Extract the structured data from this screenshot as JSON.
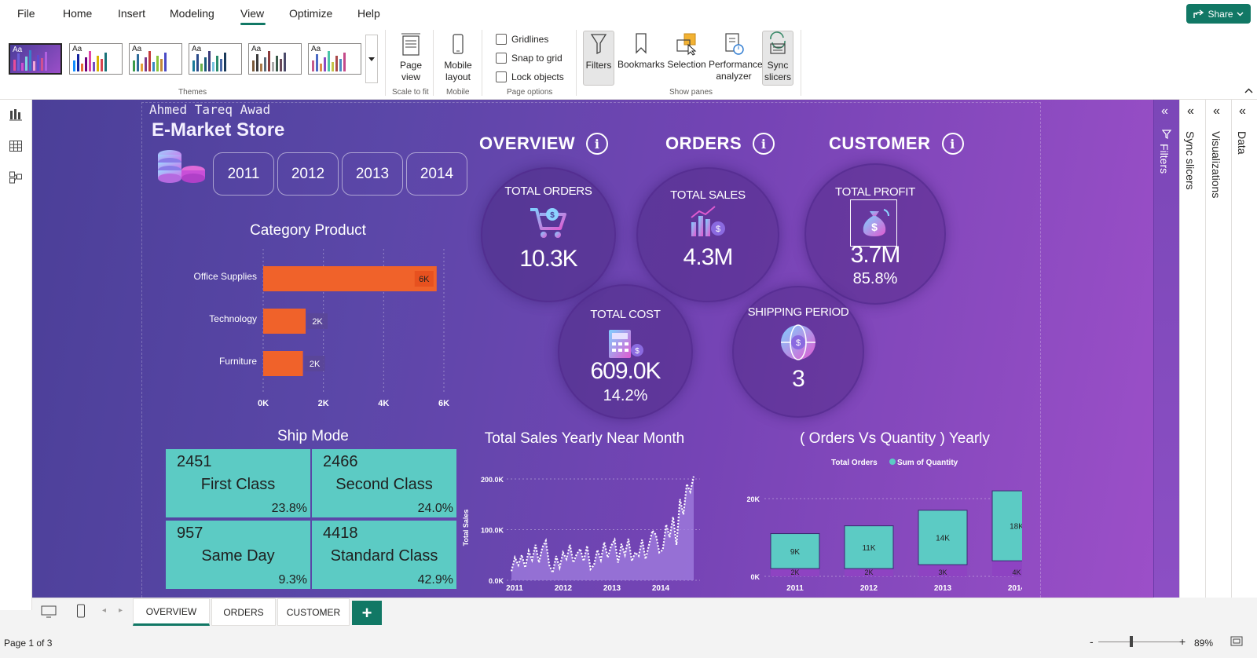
{
  "menu": {
    "items": [
      "File",
      "Home",
      "Insert",
      "Modeling",
      "View",
      "Optimize",
      "Help"
    ],
    "active": "View",
    "share_label": "Share"
  },
  "ribbon": {
    "themes_label": "Themes",
    "theme_aa": "Aa",
    "page_view_label": "Page view",
    "scale_to_fit_label": "Scale to fit",
    "mobile_layout_label": "Mobile layout",
    "mobile_group_label": "Mobile",
    "gridlines_label": "Gridlines",
    "snap_label": "Snap to grid",
    "lock_label": "Lock objects",
    "page_options_label": "Page options",
    "filters_label": "Filters",
    "bookmarks_label": "Bookmarks",
    "selection_label": "Selection",
    "performance_label": "Performance analyzer",
    "sync_label": "Sync slicers",
    "show_panes_label": "Show panes"
  },
  "report": {
    "author": "Ahmed Tareq Awad",
    "title": "E-Market Store",
    "years": [
      "2011",
      "2012",
      "2013",
      "2014"
    ],
    "sections": {
      "overview": "OVERVIEW",
      "orders": "ORDERS",
      "customer": "CUSTOMER"
    },
    "kpis": {
      "total_orders": {
        "label": "TOTAL ORDERS",
        "value": "10.3K"
      },
      "total_sales": {
        "label": "TOTAL SALES",
        "value": "4.3M"
      },
      "total_profit": {
        "label": "TOTAL PROFIT",
        "value": "3.7M",
        "sub": "85.8%"
      },
      "total_cost": {
        "label": "TOTAL COST",
        "value": "609.0K",
        "sub": "14.2%"
      },
      "shipping_period": {
        "label": "SHIPPING PERIOD",
        "value": "3"
      }
    },
    "ship_mode": {
      "title": "Ship Mode",
      "cells": [
        {
          "count": "2451",
          "name": "First Class",
          "pct": "23.8%"
        },
        {
          "count": "2466",
          "name": "Second Class",
          "pct": "24.0%"
        },
        {
          "count": "957",
          "name": "Same Day",
          "pct": "9.3%"
        },
        {
          "count": "4418",
          "name": "Standard Class",
          "pct": "42.9%"
        }
      ]
    }
  },
  "chart_data": [
    {
      "type": "bar",
      "orientation": "horizontal",
      "title": "Category Product",
      "categories": [
        "Office Supplies",
        "Technology",
        "Furniture"
      ],
      "values": [
        6000,
        2000,
        2000
      ],
      "data_labels": [
        "6K",
        "2K",
        "2K"
      ],
      "xticks": [
        "0K",
        "2K",
        "4K",
        "6K"
      ],
      "xlim": [
        0,
        6000
      ],
      "color": "#f0622a"
    },
    {
      "type": "area",
      "title": "Total Sales Yearly Near Month",
      "ylabel": "Total Sales",
      "x_ticks": [
        "2011",
        "2012",
        "2013",
        "2014"
      ],
      "y_ticks": [
        "0.0K",
        "100.0K",
        "200.0K"
      ],
      "ylim": [
        0,
        200000
      ],
      "values": [
        18000,
        45000,
        30000,
        50000,
        25000,
        58000,
        40000,
        70000,
        35000,
        65000,
        78000,
        30000,
        15000,
        48000,
        25000,
        55000,
        42000,
        70000,
        35000,
        52000,
        62000,
        38000,
        68000,
        22000,
        30000,
        60000,
        40000,
        75000,
        45000,
        68000,
        80000,
        35000,
        72000,
        50000,
        82000,
        38000,
        55000,
        48000,
        80000,
        42000,
        70000,
        98000,
        90000,
        55000,
        60000,
        110000,
        85000,
        125000,
        70000,
        160000,
        130000,
        190000,
        175000,
        205000
      ],
      "color": "#a17fe0"
    },
    {
      "type": "bar",
      "title": "( Orders Vs Quantity ) Yearly",
      "legend": [
        "Total Orders",
        "Sum of Quantity"
      ],
      "categories": [
        "2011",
        "2012",
        "2013",
        "2014"
      ],
      "series": [
        {
          "name": "Total Orders",
          "values": [
            2000,
            2000,
            3000,
            4000
          ],
          "labels": [
            "2K",
            "2K",
            "3K",
            "4K"
          ],
          "color": "#8e43c2"
        },
        {
          "name": "Sum of Quantity",
          "values": [
            9000,
            11000,
            14000,
            18000
          ],
          "labels": [
            "9K",
            "11K",
            "14K",
            "18K"
          ],
          "color": "#5ccbc4"
        }
      ],
      "y_ticks": [
        "0K",
        "20K"
      ],
      "ylim": [
        0,
        20000
      ]
    }
  ],
  "tabs": [
    "OVERVIEW",
    "ORDERS",
    "CUSTOMER"
  ],
  "active_tab": "OVERVIEW",
  "panes": {
    "filters": "Filters",
    "sync_slicers": "Sync slicers",
    "visualizations": "Visualizations",
    "data": "Data"
  },
  "status": {
    "page": "Page 1 of 3",
    "zoom": "89%"
  }
}
